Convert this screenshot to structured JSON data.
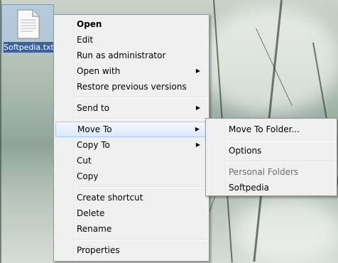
{
  "desktop": {
    "file_label": "Softpedia.txt"
  },
  "context_menu": {
    "items": [
      {
        "label": "Open"
      },
      {
        "label": "Edit"
      },
      {
        "label": "Run as administrator"
      },
      {
        "label": "Open with"
      },
      {
        "label": "Restore previous versions"
      },
      {
        "label": "Send to"
      },
      {
        "label": "Move To"
      },
      {
        "label": "Copy To"
      },
      {
        "label": "Cut"
      },
      {
        "label": "Copy"
      },
      {
        "label": "Create shortcut"
      },
      {
        "label": "Delete"
      },
      {
        "label": "Rename"
      },
      {
        "label": "Properties"
      }
    ],
    "submenu_arrow": "▶"
  },
  "submenu": {
    "items": [
      {
        "label": "Move To Folder..."
      },
      {
        "label": "Options"
      },
      {
        "label": "Personal Folders"
      },
      {
        "label": "Softpedia"
      }
    ]
  },
  "colors": {
    "menu_bg": "#f0f0f0",
    "hover_border": "#a8c8f0",
    "selection": "#3b5fa3"
  }
}
